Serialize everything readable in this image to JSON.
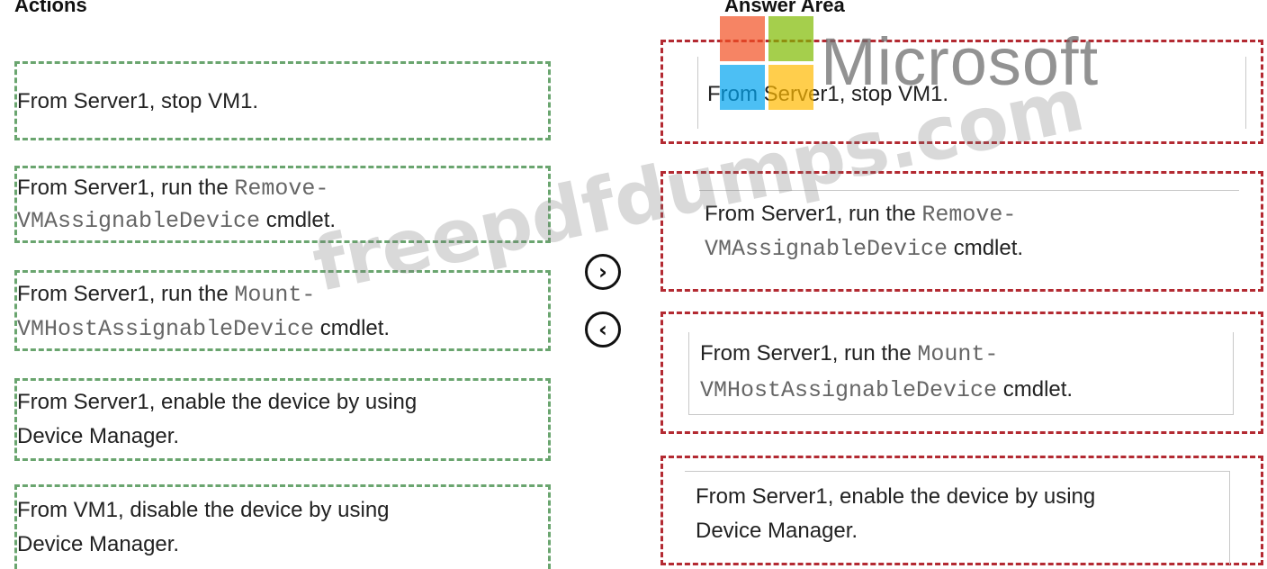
{
  "actions": {
    "heading": "Actions",
    "items": [
      {
        "line1_prefix": "From Server1, stop VM1.",
        "line1_code": "",
        "line2_code": "",
        "line2_suffix": ""
      },
      {
        "line1_prefix": "From Server1, run the ",
        "line1_code": "Remove-",
        "line2_code": "VMAssignableDevice",
        "line2_suffix": " cmdlet."
      },
      {
        "line1_prefix": "From Server1, run the ",
        "line1_code": "Mount-",
        "line2_code": "VMHostAssignableDevice",
        "line2_suffix": " cmdlet."
      },
      {
        "line1_prefix": "From Server1, enable the device by using",
        "line1_code": "",
        "line2_code": "",
        "line2_suffix": "Device Manager."
      },
      {
        "line1_prefix": "From VM1, disable the device by using",
        "line1_code": "",
        "line2_code": "",
        "line2_suffix": "Device Manager."
      }
    ]
  },
  "answer_area": {
    "heading": "Answer Area",
    "items": [
      {
        "line1_prefix": "From Server1, stop VM1.",
        "line1_code": "",
        "line2_code": "",
        "line2_suffix": ""
      },
      {
        "line1_prefix": "From Server1, run the ",
        "line1_code": "Remove-",
        "line2_code": "VMAssignableDevice",
        "line2_suffix": " cmdlet."
      },
      {
        "line1_prefix": "From Server1, run the ",
        "line1_code": "Mount-",
        "line2_code": "VMHostAssignableDevice",
        "line2_suffix": " cmdlet."
      },
      {
        "line1_prefix": "From Server1, enable the device by using",
        "line1_code": "",
        "line2_code": "",
        "line2_suffix": "Device Manager."
      }
    ]
  },
  "controls": {
    "move_right_glyph": "›",
    "move_left_glyph": "‹"
  },
  "overlays": {
    "watermark_text": "freepdfdumps.com",
    "logo_text": "Microsoft"
  },
  "colors": {
    "action_border": "#6aa56f",
    "answer_border": "#b32a32"
  },
  "icons": [
    "chevron-right-icon",
    "chevron-left-icon",
    "microsoft-logo-icon"
  ]
}
